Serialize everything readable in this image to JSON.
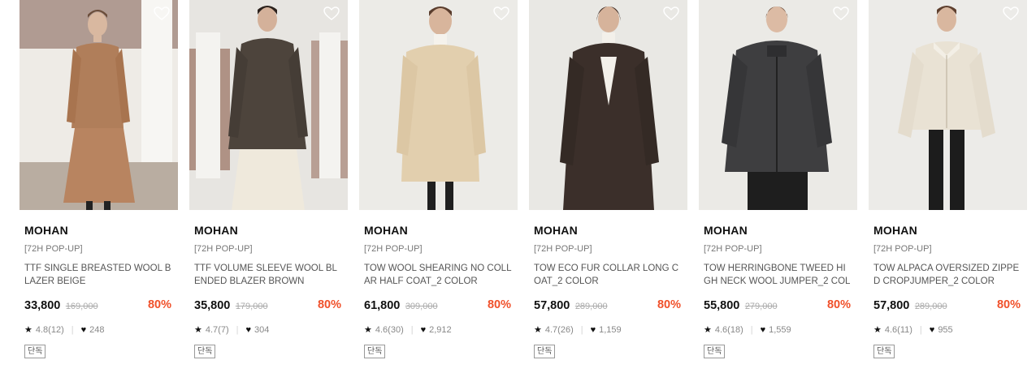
{
  "products": [
    {
      "brand": "MOHAN",
      "tag": "[72H POP-UP]",
      "name": "TTF SINGLE BREASTED WOOL BLAZER BEIGE",
      "price": "33,800",
      "original_price": "169,000",
      "discount": "80%",
      "rating": "4.8(12)",
      "likes": "248",
      "badge": "단독"
    },
    {
      "brand": "MOHAN",
      "tag": "[72H POP-UP]",
      "name": "TTF VOLUME SLEEVE WOOL BLENDED BLAZER BROWN",
      "price": "35,800",
      "original_price": "179,000",
      "discount": "80%",
      "rating": "4.7(7)",
      "likes": "304",
      "badge": "단독"
    },
    {
      "brand": "MOHAN",
      "tag": "[72H POP-UP]",
      "name": "TOW WOOL SHEARING NO COLLAR HALF COAT_2 COLOR",
      "price": "61,800",
      "original_price": "309,000",
      "discount": "80%",
      "rating": "4.6(30)",
      "likes": "2,912",
      "badge": "단독"
    },
    {
      "brand": "MOHAN",
      "tag": "[72H POP-UP]",
      "name": "TOW ECO FUR COLLAR LONG COAT_2 COLOR",
      "price": "57,800",
      "original_price": "289,000",
      "discount": "80%",
      "rating": "4.7(26)",
      "likes": "1,159",
      "badge": "단독"
    },
    {
      "brand": "MOHAN",
      "tag": "[72H POP-UP]",
      "name": "TOW HERRINGBONE TWEED HIGH NECK WOOL JUMPER_2 COLOR",
      "price": "55,800",
      "original_price": "279,000",
      "discount": "80%",
      "rating": "4.6(18)",
      "likes": "1,559",
      "badge": "단독"
    },
    {
      "brand": "MOHAN",
      "tag": "[72H POP-UP]",
      "name": "TOW ALPACA OVERSIZED ZIPPED CROPJUMPER_2 COLOR",
      "price": "57,800",
      "original_price": "289,000",
      "discount": "80%",
      "rating": "4.6(11)",
      "likes": "955",
      "badge": "단독"
    }
  ],
  "colors": {
    "discount": "#f0502a",
    "price": "#111111",
    "muted": "#888888"
  },
  "icons": {
    "wishlist": "heart-outline-icon",
    "rating": "star-icon",
    "likes": "heart-filled-icon"
  }
}
